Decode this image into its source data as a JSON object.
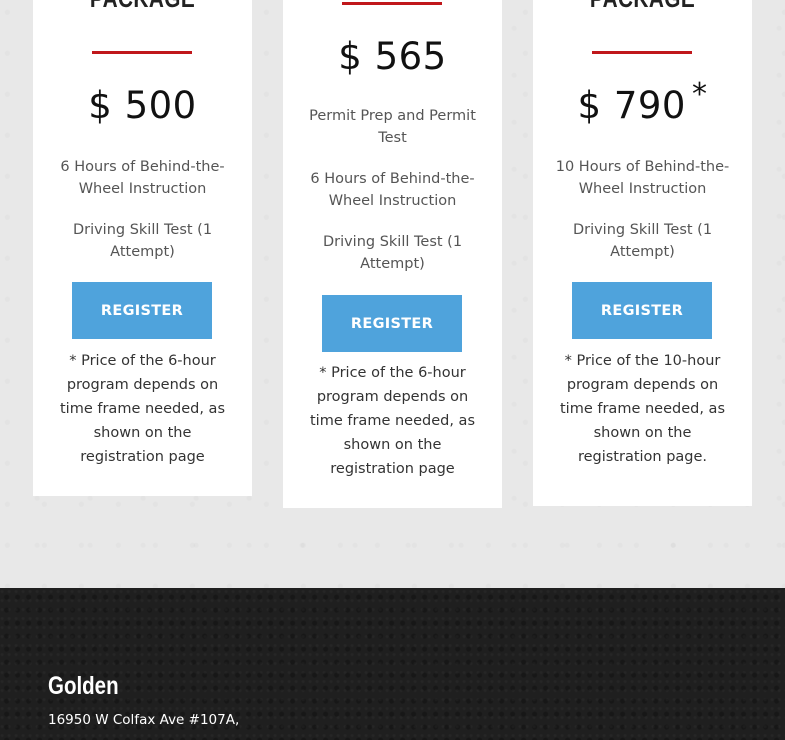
{
  "packages": [
    {
      "title": "PACKAGE",
      "price": "$ 500",
      "price_marker": "",
      "features": [
        "6 Hours of Behind-the-Wheel Instruction",
        "Driving Skill Test (1 Attempt)"
      ],
      "register_label": "REGISTER",
      "note": "* Price of the 6-hour program depends on time frame needed, as shown on the registration page"
    },
    {
      "title": "",
      "price": "$ 565",
      "price_marker": "",
      "features": [
        "Permit Prep and Permit Test",
        "6 Hours of Behind-the-Wheel Instruction",
        "Driving Skill Test (1 Attempt)"
      ],
      "register_label": "REGISTER",
      "note": "* Price of the 6-hour program depends on time frame needed, as shown on the registration page"
    },
    {
      "title": "PACKAGE",
      "price": "$ 790",
      "price_marker": "*",
      "features": [
        "10 Hours of Behind-the-Wheel Instruction",
        "Driving Skill Test (1 Attempt)"
      ],
      "register_label": "REGISTER",
      "note": "* Price of the 10-hour program depends on time frame needed, as shown on the registration page."
    }
  ],
  "footer": {
    "location_title": "Golden",
    "address": "16950 W Colfax Ave #107A,"
  },
  "colors": {
    "accent_red": "#c0171b",
    "button_blue": "#4fa3dc",
    "footer_bg": "#1f1f1f"
  }
}
